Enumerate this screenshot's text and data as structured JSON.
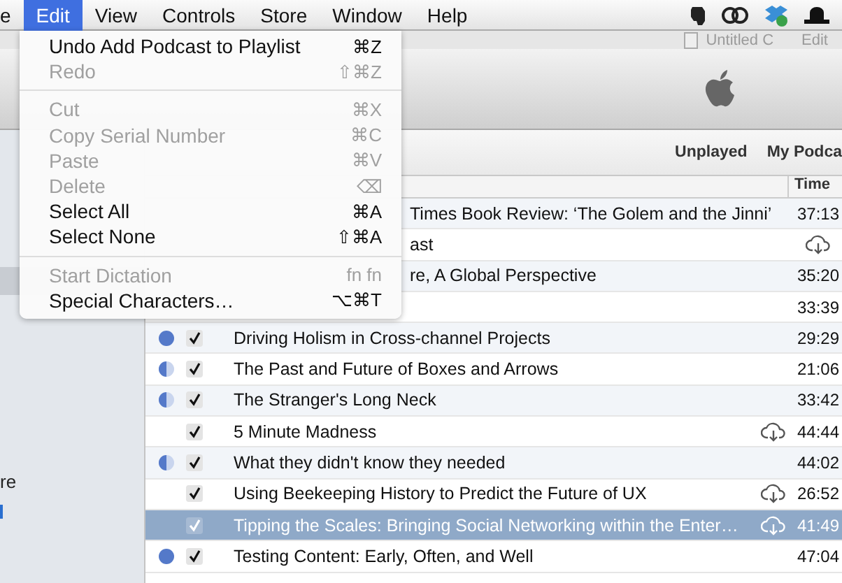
{
  "menubar": {
    "items": [
      {
        "label": "e",
        "selected": false
      },
      {
        "label": "Edit",
        "selected": true
      },
      {
        "label": "View",
        "selected": false
      },
      {
        "label": "Controls",
        "selected": false
      },
      {
        "label": "Store",
        "selected": false
      },
      {
        "label": "Window",
        "selected": false
      },
      {
        "label": "Help",
        "selected": false
      }
    ]
  },
  "back_window": {
    "title": "Untitled C",
    "menu": "Edit"
  },
  "edit_menu": [
    {
      "kind": "item",
      "label": "Undo Add Podcast to Playlist",
      "shortcut": "⌘Z",
      "disabled": false
    },
    {
      "kind": "item",
      "label": "Redo",
      "shortcut": "⇧⌘Z",
      "disabled": true
    },
    {
      "kind": "separator"
    },
    {
      "kind": "item",
      "label": "Cut",
      "shortcut": "⌘X",
      "disabled": true
    },
    {
      "kind": "item",
      "label": "Copy Serial Number",
      "shortcut": "⌘C",
      "disabled": true
    },
    {
      "kind": "item",
      "label": "Paste",
      "shortcut": "⌘V",
      "disabled": true
    },
    {
      "kind": "item",
      "label": "Delete",
      "shortcut": "⌫",
      "disabled": true
    },
    {
      "kind": "item",
      "label": "Select All",
      "shortcut": "⌘A",
      "disabled": false
    },
    {
      "kind": "item",
      "label": "Select None",
      "shortcut": "⇧⌘A",
      "disabled": false
    },
    {
      "kind": "separator"
    },
    {
      "kind": "item",
      "label": "Start Dictation",
      "shortcut": "fn fn",
      "disabled": true
    },
    {
      "kind": "item",
      "label": "Special Characters…",
      "shortcut": "⌥⌘T",
      "disabled": false
    }
  ],
  "sidebar": {
    "texts": [
      "re"
    ]
  },
  "tabs": [
    {
      "label": "Unplayed",
      "selected": false
    },
    {
      "label": "My Podca",
      "selected": false
    }
  ],
  "table": {
    "columns": [
      "Time"
    ],
    "rows": [
      {
        "kind": "covered",
        "title": "Times Book Review: ‘The Golem and the Jinni’",
        "cloud": false,
        "time": "37:13",
        "selected": false
      },
      {
        "kind": "covered",
        "title": "ast",
        "cloud": true,
        "selected": false
      },
      {
        "kind": "covered",
        "title": "re, A Global Perspective",
        "cloud": false,
        "time": "35:20",
        "selected": false
      },
      {
        "kind": "covered",
        "cloud": false,
        "time": "33:39",
        "selected": false
      },
      {
        "kind": "episode",
        "unplayed": true,
        "partial": false,
        "checked": true,
        "title": "Driving Holism in Cross-channel Projects",
        "cloud": false,
        "time": "29:29",
        "selected": false
      },
      {
        "kind": "episode",
        "unplayed": false,
        "partial": true,
        "checked": true,
        "title": "The Past and Future of Boxes and Arrows",
        "cloud": false,
        "time": "21:06",
        "selected": false
      },
      {
        "kind": "episode",
        "unplayed": false,
        "partial": true,
        "checked": true,
        "title": "The Stranger's Long Neck",
        "cloud": false,
        "time": "33:42",
        "selected": false
      },
      {
        "kind": "episode",
        "unplayed": false,
        "partial": false,
        "checked": true,
        "title": "5 Minute Madness",
        "cloud": true,
        "time": "44:44",
        "selected": false
      },
      {
        "kind": "episode",
        "unplayed": false,
        "partial": true,
        "checked": true,
        "title": "What they didn't know they needed",
        "cloud": false,
        "time": "44:02",
        "selected": false
      },
      {
        "kind": "episode",
        "unplayed": false,
        "partial": false,
        "checked": true,
        "title": "Using Beekeeping History to Predict the Future of UX",
        "cloud": true,
        "time": "26:52",
        "selected": false
      },
      {
        "kind": "episode",
        "unplayed": false,
        "partial": false,
        "checked": true,
        "title": "Tipping the Scales: Bringing Social Networking within the Enter…",
        "cloud": true,
        "time": "41:49",
        "selected": true
      },
      {
        "kind": "episode",
        "unplayed": true,
        "partial": false,
        "checked": true,
        "title": "Testing Content: Early, Often, and Well",
        "cloud": false,
        "time": "47:04",
        "selected": false
      }
    ]
  }
}
